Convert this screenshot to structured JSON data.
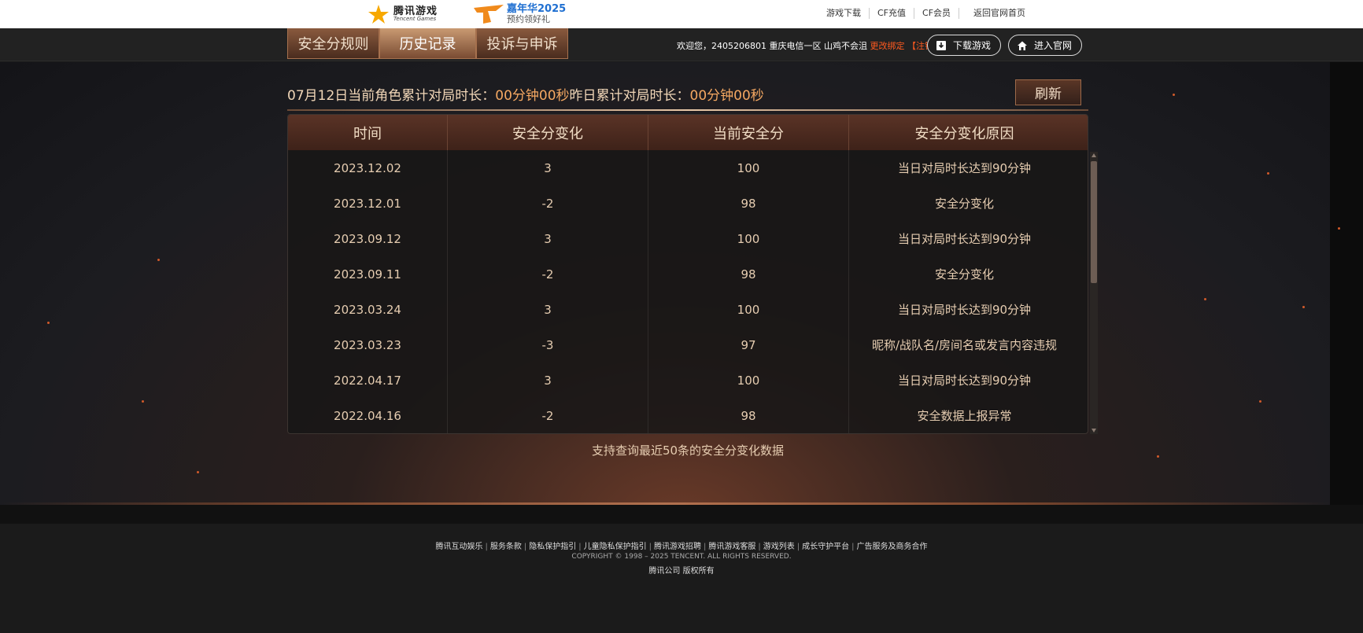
{
  "header": {
    "logo_tencent_cn": "腾讯游戏",
    "logo_tencent_en": "Tencent Games",
    "logo_cf_title": "嘉年华2025",
    "logo_cf_sub": "预约领好礼",
    "links": [
      "游戏下载",
      "CF充值",
      "CF会员",
      "返回官网首页"
    ]
  },
  "nav": {
    "tabs": [
      "安全分规则",
      "历史记录",
      "投诉与申诉"
    ],
    "welcome_prefix": "欢迎您，2405206801 重庆电信一区 山鸡不会沮",
    "change_binding": "更改绑定",
    "logout": "【注销】",
    "download_button": "下载游戏",
    "official_button": "进入官网"
  },
  "stats": {
    "date_label": "07月12日当前角色累计对局时长：",
    "today_value": "00分钟00秒",
    "yesterday_label": "昨日累计对局时长：",
    "yesterday_value": "00分钟00秒",
    "refresh_label": "刷新"
  },
  "table": {
    "headers": [
      "时间",
      "安全分变化",
      "当前安全分",
      "安全分变化原因"
    ],
    "rows": [
      [
        "2023.12.02",
        "3",
        "100",
        "当日对局时长达到90分钟"
      ],
      [
        "2023.12.01",
        "-2",
        "98",
        "安全分变化"
      ],
      [
        "2023.09.12",
        "3",
        "100",
        "当日对局时长达到90分钟"
      ],
      [
        "2023.09.11",
        "-2",
        "98",
        "安全分变化"
      ],
      [
        "2023.03.24",
        "3",
        "100",
        "当日对局时长达到90分钟"
      ],
      [
        "2023.03.23",
        "-3",
        "97",
        "昵称/战队名/房间名或发言内容违规"
      ],
      [
        "2022.04.17",
        "3",
        "100",
        "当日对局时长达到90分钟"
      ],
      [
        "2022.04.16",
        "-2",
        "98",
        "安全数据上报异常"
      ]
    ],
    "note": "支持查询最近50条的安全分变化数据"
  },
  "footer": {
    "links": [
      "腾讯互动娱乐",
      "服务条款",
      "隐私保护指引",
      "儿童隐私保护指引",
      "腾讯游戏招聘",
      "腾讯游戏客服",
      "游戏列表",
      "成长守护平台",
      "广告服务及商务合作"
    ],
    "copyright": "COPYRIGHT © 1998 – 2025 TENCENT. ALL RIGHTS RESERVED.",
    "corp": "腾讯公司 版权所有"
  },
  "colors": {
    "accent": "#f5a862",
    "warn": "#ff5a1f",
    "tab_bg": "#7a4c33"
  }
}
